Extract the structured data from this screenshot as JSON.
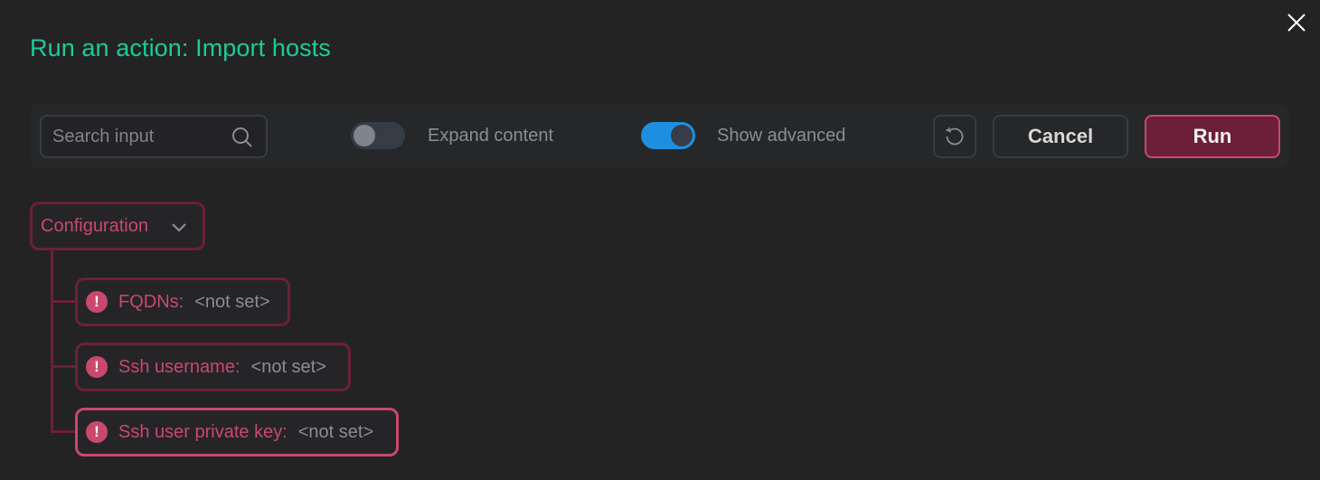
{
  "dialog": {
    "title": "Run an action: Import hosts",
    "close_icon": "close-icon"
  },
  "toolbar": {
    "search": {
      "placeholder": "Search input",
      "value": "",
      "icon": "search-icon"
    },
    "expand_content": {
      "label": "Expand content",
      "checked": false
    },
    "show_advanced": {
      "label": "Show advanced",
      "checked": true
    },
    "reset_icon": "reset-icon",
    "cancel_label": "Cancel",
    "run_label": "Run"
  },
  "colors": {
    "title": "#1dcb9a",
    "error": "#c9486e",
    "error_dark": "#6c1f38",
    "toggle_on": "#1e8fe0",
    "background": "#232323"
  },
  "config": {
    "group_label": "Configuration",
    "group_icon": "chevron-down-icon",
    "fields": [
      {
        "name": "FQDNs:",
        "value": "<not set>",
        "status": "error"
      },
      {
        "name": "Ssh username:",
        "value": "<not set>",
        "status": "error"
      },
      {
        "name": "Ssh user private key:",
        "value": "<not set>",
        "status": "error"
      }
    ],
    "error_icon_glyph": "!"
  }
}
